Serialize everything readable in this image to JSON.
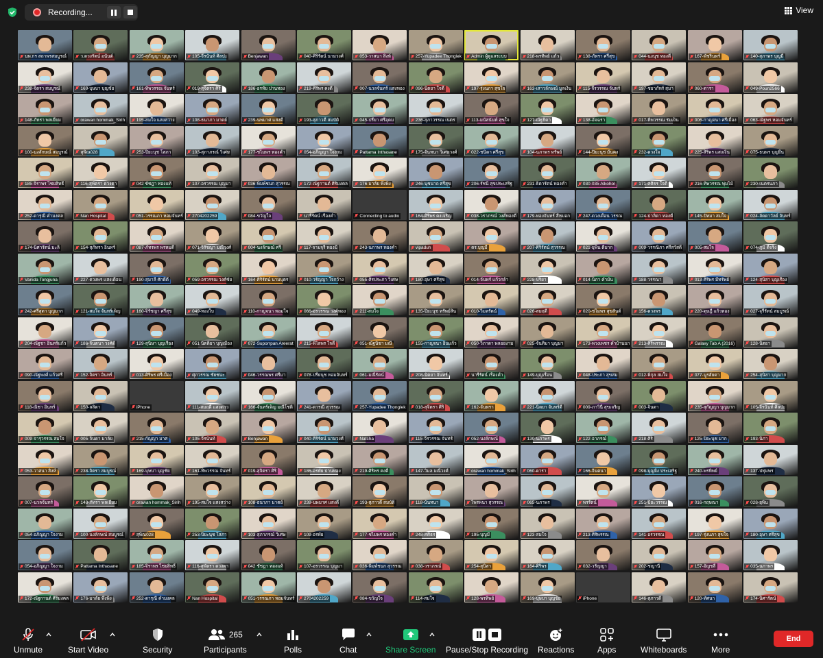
{
  "recording": {
    "label": "Recording..."
  },
  "view": {
    "label": "View"
  },
  "participants_labels": [
    "นพ.กร สถาพรสมบูรณ์",
    "ว.ดวงรัตน์ อนันต์",
    "235-สุกัญญา บุญมาก",
    "105-จีรนันท์ ศิลปะ",
    "Benjawan",
    "040-ศิริรัตน์ นามวงศ์",
    "053-วาสนา สิงห์",
    "257-Yupadee Thonglek",
    "Admin ผู้ดูแลระบบ",
    "218-พรทิพย์ แก้ว",
    "138-ภัทรา ศรีสุข",
    "044-นงนุช ทองดี",
    "167-พัชรินทร์",
    "140-สุภาพร บุญมี",
    "238-จิตรา สมบูรณ์",
    "169-บุษบา บุญชัย",
    "161-ทิพวรรณ จันทร์",
    "019-สุจิตรา ศิริ",
    "186-อรทัย ปานทอง",
    "219-ศิริพร คงดี",
    "007-นวลจันทร์ แสงทอง",
    "096-นิตยา ใจดี",
    "197-รุ่งนภา สุขใจ",
    "163-เสาวลักษณ์ มูลเงิน",
    "115-จีรวรรณ จันทร์",
    "197-ชยาภัทร์ สุมา",
    "060-ดารา",
    "049-Poun2566",
    "148-ภัทรา พลเยี่ยม",
    "orawan hommak_Sirih",
    "195-สมใจ แสงสว่าง",
    "108-ธนาภา มาตย์",
    "239-นพมาศ แสงดี",
    "193-สุภาวดี สมบัติ",
    "045-ปรียา ศรีอุดม",
    "236-สุภาวรรณ เนตร",
    "113-มนัสนันท์ สุขใจ",
    "127-ณัฐธิดา",
    "138-อัจฉรา",
    "017-ทิพวรรณ ร่มเย็น",
    "006-กาญจนา ศรีเมือง",
    "063-ณัฐพร หอมจันทร์",
    "100-นงลักษณ์ สมบูรณ์",
    "สุพิณ028",
    "253-ปิยะนุช โสภา",
    "103-สุภาภรณ์ วิเศษ",
    "177-ชไมพร ทองคำ",
    "054-อภิญญา ใจงาม",
    "Pattama Inthasane",
    "175-จันทนา วิเศษวงศ์",
    "022-ชนิดา ศรีสุข",
    "104-นภาพร ทรัพย์",
    "144-ปิยะนุช มั่นคง",
    "232-ดวงใจ",
    "225-สิริพร แสงเงิน",
    "075-ธนพร บุญยืน",
    "185-จิราพร ไชยสิทธิ์",
    "116-สุพัตรา ดวงตา",
    "042 ชัชฎา ทองแท้",
    "107-อรวรรณ บุญมา",
    "036-พิมพ์ชนก สุวรรณ",
    "172-ณัฐกานต์ ศิริมงคล",
    "176-มาลัย พึ่งพิง",
    "246-นุชนาถ ศรีสุข",
    "206-รัชนี สุขประเสริฐ",
    "231-ธิดารัตน์ ทองคำ",
    "030-035 Alkohol",
    "171-ศศิธร ใจดี",
    "216-ทิพวรรณ พุ่มไม้",
    "230-เนตรนภา",
    "252-ดารุณี คำมงคล",
    "Nan Hospital",
    "051-วรรณภา หอมจันทร์",
    "2704202259",
    "084-ขวัญใจ",
    "นารีรัตน์ เรืองคำ",
    "Connecting to audio",
    "164-ศิริพร คงเจริญ",
    "038-วราภรณ์ วงศ์ทองดี",
    "179-ทองจันทร์ สีหมอก",
    "247-ดวงเดือน วรรณ",
    "124-ปาลิดา ทองดี",
    "145-ปัทมา สมใจ",
    "024-ลัดดาวัลย์ จันทร์",
    "174-นิศารัตน์ มะลิ",
    "154-สุภัทรา อินทร์",
    "087-ภัทรพร พรหมดี",
    "071-จิรัชญา มณีวงศ์",
    "004-นงลักษณ์ ศรี",
    "117-จามจุรี ทองมี",
    "243-นภาพร ทองคำ",
    "vipaduh",
    "ดร.บุญมี",
    "207-ศิริรัตน์ สุวรรณ",
    "021-ยุพิน ดีมาก",
    "009-วรรณิภา ศรีสวัสดิ์",
    "005-สมใจ",
    "074-ภูมิ ดีจริง",
    "Vanida Tongjuna",
    "227-ดวงพร แสงเดือน",
    "190-สุมาลี ศักดิ์ดี",
    "059-อรวรรณ วงศ์ชัย",
    "164-ศิริรัตน์ นามบุตร",
    "010-วรัญญา ใจกว้าง",
    "055-ศิรประภา วิเศษ",
    "180-อุษา ศรีสุข",
    "014-จันทร์ แก้วกล้า",
    "228-ปริยา",
    "014-นิภา คำมั่น",
    "188-วรรณา",
    "013-ศิริพร มีทรัพย์",
    "124-สุนิสา บุญเรือง",
    "242-ศรีสุดา บุญมาก",
    "121-สมใจ จันทร์เพ็ญ",
    "160-จิรัชญา ศรีสุข",
    "049-ทองใบ",
    "110-กาญจนา หอมใจ",
    "066-อรวรรณ วงศ์ทอง",
    "211-สมใจ",
    "135-ปิยะนุช ทรัพย์สิน",
    "010-วิมลรัตน์",
    "026-สมฤดี",
    "020-ชไมพร สุขสันต์",
    "156-ดวงพร",
    "220-ดุษฎี แก้วทอง",
    "027-จุรีรัตน์ สมบูรณ์",
    "204-ณัฐชา อินทร์แก้ว",
    "186-จินตนา วงศ์ดี",
    "129-สุนิษา บุญเรือง",
    "051 นิตติยา บุญเมือง",
    "072-Suporrpan Areerat",
    "215-พิไลพร ใจดี",
    "051-ณัฐนิชา มณี",
    "155-กาญจนา อินแก้ว",
    "050-วิภาดา พลอยงาม",
    "025-จันทิมา บุญมา",
    "173-พวงเพชร คำบ้านนา",
    "213-ศิริพรรณ",
    "Galaxy Tab A (2016)",
    "128-นิตยา",
    "090-ณัฐพงศ์ แก้วศรี",
    "152-จิตรา อินทร์",
    "013-ศิริพร ศรีเมือง",
    "ศุภวรรณ ชัยชนะ",
    "046-วรรณพร ศรีมา",
    "078-ปรียนุช หอมจันทร์",
    "061-มณีรัตน์",
    "208-นิตยา จันทร์",
    "นารีรัตน์ เรืองคำ",
    "149-บุญเรือน",
    "048-ประภา สุขสม",
    "012-พิกุล สมใจ",
    "077-นูรฮัยดา",
    "254-สุนิสา บุญมาก",
    "118-ณิชา อินทร์",
    "150-ลลิตา",
    "iPhone",
    "111-สมฤดี แสงดาว",
    "166-จันทร์เพ็ญ มณีโชติ",
    "241-ดารณี สุวรรณ",
    "257-Yupadee Thonglek",
    "018-สุจิตรา ศิริ",
    "162-จันทรา",
    "221-นิตยา จันทร์ดี",
    "009-ภาวินี สุขเจริญ",
    "003-จินดา",
    "235-สุกัญญา บุญมาก",
    "105-จีรนันท์ ศิลปะ",
    "009-จารุวรรณ สมใจ",
    "005-จินดา มาลัย",
    "215-กัญญา มาศ",
    "105-จีรนันท์",
    "Benjawan",
    "040-ศิริรัตน์ นามวงศ์",
    "Natcha",
    "115-จีรวรรณ จันทร์",
    "052-นงลักษณ์",
    "130-นภาพร",
    "122-อาภรณ์",
    "218-ศิริ",
    "125-ปิยะนุช มาก",
    "193-นิภา",
    "053-วาสนา สิงห์",
    "238-จิตรา สมบูรณ์",
    "169-บุษบา บุญชัย",
    "161-ทิพวรรณ จันทร์",
    "019-สุจิตรา ศิริ",
    "186-อรทัย ปานทอง",
    "219-ศิริพร คงดี",
    "147-วิมล มณีวงศ์",
    "orawan hommak_Sirih",
    "060-ดารา",
    "166-จินตนา",
    "098-บุญยิ่ง ประเสริฐ",
    "240-พรทิพย์",
    "137-ปทุมพร",
    "007-นวลจันทร์",
    "148-ภัทรา พลเยี่ยม",
    "orawan hommak_Sirih",
    "195-สมใจ แสงสว่าง",
    "108-ธนาภา มาตย์",
    "239-นพมาศ แสงดี",
    "193-สุภาวดี สมบัติ",
    "118-นันทนา",
    "ไพรพนา สุวรรณ",
    "065-นภาพร",
    "พรรัตน์",
    "251-ปิยะวรรณ",
    "016-กฤษณา",
    "028-ยุพิน",
    "054-อภิญญา ใจงาม",
    "100-นงลักษณ์ สมบูรณ์",
    "สุพิณ028",
    "253-ปิยะนุช โสภา",
    "103-สุภาภรณ์ วิเศษ",
    "109-อรทัย",
    "177-ชไมพร ทองคำ",
    "248-ศศิธร",
    "195-บุญมี",
    "123-สมใจ",
    "213-ศิริพรรณ",
    "141-อรวรรณ",
    "197-รุ่งนภา สุขใจ",
    "180-อุษา ศรีสุข",
    "054-อภิญญา ใจงาม",
    "Pattama Inthasane",
    "185-จิราพร ไชยสิทธิ์",
    "116-สุพัตรา ดวงตา",
    "042 ชัชฎา ทองแท้",
    "107-อรวรรณ บุญมา",
    "036-พิมพ์ชนก สุวรรณ",
    "038-วราภรณ์",
    "254-สุนิสา",
    "164-ศิริพร",
    "032-วรัญญา",
    "202-ชญานี",
    "157-อัญชลี",
    "035-นภาพร",
    "172-ณัฐกานต์ ศิริมงคล",
    "176-มาลัย พึ่งพิง",
    "252-ดารุณี คำมงคล",
    "Nan Hospital",
    "051-วรรณภา หอมจันทร์",
    "2704202259",
    "084-ขวัญใจ",
    "114-สมใจ",
    "128-พรทิพย์",
    "169-บุษบา บุญชัย",
    "iPhone",
    "146-สุภาวดี",
    "120-ทัศนา",
    "174-นิศารัตน์"
  ],
  "toolbar": {
    "unmute": "Unmute",
    "start_video": "Start Video",
    "security": "Security",
    "participants": "Participants",
    "participants_count": "265",
    "polls": "Polls",
    "chat": "Chat",
    "share_screen": "Share Screen",
    "pause_stop_recording": "Pause/Stop Recording",
    "reactions": "Reactions",
    "apps": "Apps",
    "whiteboards": "Whiteboards",
    "more": "More",
    "end": "End"
  },
  "colors": {
    "accent_green": "#21c87a",
    "end_red": "#e02828",
    "background": "#1a1a1a"
  }
}
